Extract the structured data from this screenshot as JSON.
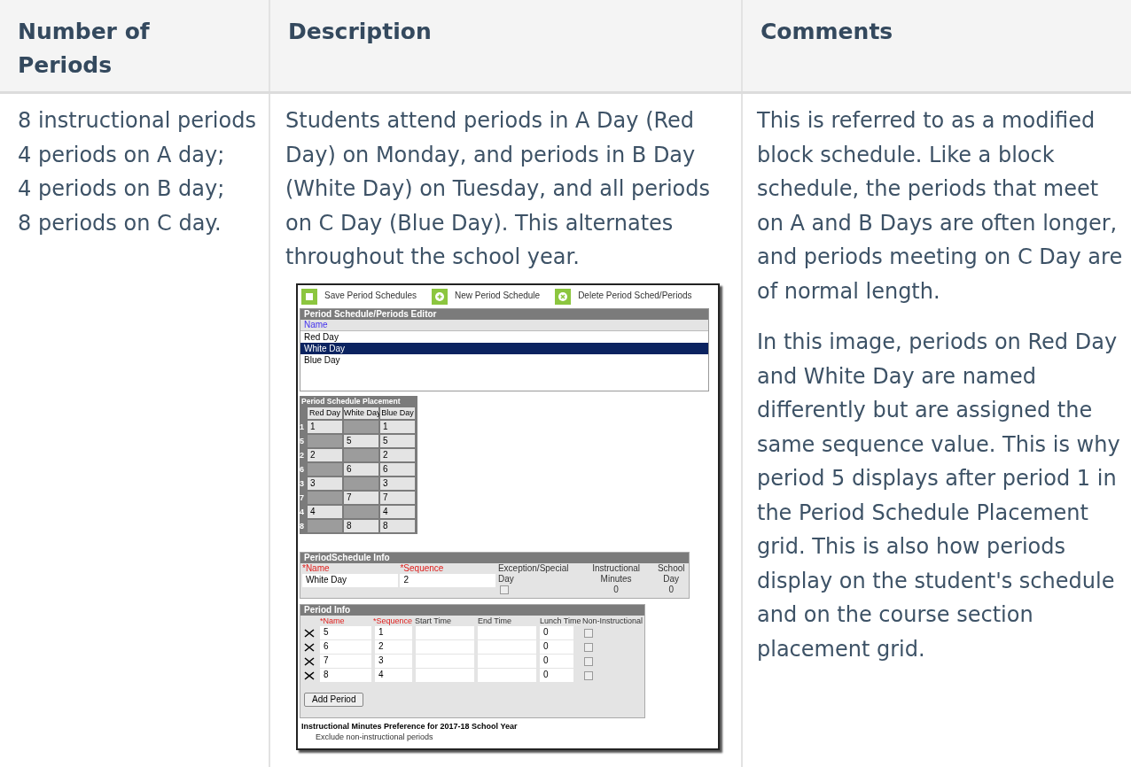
{
  "table": {
    "columns": [
      "Number of Periods",
      "Description",
      "Comments"
    ],
    "rows": [
      {
        "number_of_periods": [
          "8 instructional periods",
          "4 periods on A day;",
          "4 periods on B day;",
          "8 periods on C day."
        ],
        "description": "Students attend periods in A Day (Red Day) on Monday, and periods in B Day (White Day) on Tuesday, and all periods on C Day (Blue Day). This alternates throughout the school year.",
        "screenshot": {
          "toolbar": [
            {
              "kind": "save",
              "label": "Save Period Schedules"
            },
            {
              "kind": "new",
              "label": "New Period Schedule"
            },
            {
              "kind": "delete",
              "label": "Delete Period Sched/Periods"
            }
          ],
          "editor": {
            "title": "Period Schedule/Periods Editor",
            "column": "Name",
            "items": [
              {
                "name": "Red Day",
                "selected": false
              },
              {
                "name": "White Day",
                "selected": true
              },
              {
                "name": "Blue Day",
                "selected": false
              }
            ]
          },
          "placement": {
            "title": "Period Schedule Placement",
            "columns": [
              "Red Day",
              "White Day",
              "Blue Day"
            ],
            "rows": [
              {
                "label": "1",
                "cells": [
                  "1",
                  null,
                  "1"
                ]
              },
              {
                "label": "5",
                "cells": [
                  null,
                  "5",
                  "5"
                ]
              },
              {
                "label": "2",
                "cells": [
                  "2",
                  null,
                  "2"
                ]
              },
              {
                "label": "6",
                "cells": [
                  null,
                  "6",
                  "6"
                ]
              },
              {
                "label": "3",
                "cells": [
                  "3",
                  null,
                  "3"
                ]
              },
              {
                "label": "7",
                "cells": [
                  null,
                  "7",
                  "7"
                ]
              },
              {
                "label": "4",
                "cells": [
                  "4",
                  null,
                  "4"
                ]
              },
              {
                "label": "8",
                "cells": [
                  null,
                  "8",
                  "8"
                ]
              }
            ]
          },
          "schedule_info": {
            "title": "PeriodSchedule Info",
            "name_label": "*Name",
            "name_value": "White Day",
            "sequence_label": "*Sequence",
            "sequence_value": "2",
            "exception_label": "Exception/Special Day",
            "exception_checked": false,
            "minutes_label": "Instructional Minutes",
            "minutes_value": "0",
            "school_day_label": "School Day",
            "school_day_value": "0"
          },
          "period_info": {
            "title": "Period Info",
            "columns": [
              "*Name",
              "*Sequence",
              "Start Time",
              "End Time",
              "Lunch Time",
              "Non-Instructional"
            ],
            "rows": [
              {
                "name": "5",
                "sequence": "1",
                "lunch": "0",
                "non_instructional": false
              },
              {
                "name": "6",
                "sequence": "2",
                "lunch": "0",
                "non_instructional": false
              },
              {
                "name": "7",
                "sequence": "3",
                "lunch": "0",
                "non_instructional": false
              },
              {
                "name": "8",
                "sequence": "4",
                "lunch": "0",
                "non_instructional": false
              }
            ],
            "add_button": "Add Period"
          },
          "preferences": {
            "title": "Instructional Minutes Preference for 2017-18 School Year",
            "items": [
              "Exclude non-instructional periods"
            ]
          }
        },
        "comments": [
          "This is referred to as a modified block schedule. Like a block schedule, the periods that meet on A and B Days are often longer, and periods meeting on C Day are of normal length.",
          "In this image, periods on Red Day and White Day are named differently but are assigned the same sequence value. This is why period 5 displays after period 1 in the Period Schedule Placement grid. This is also how periods display on the student's schedule and on the course section placement grid."
        ]
      }
    ]
  }
}
